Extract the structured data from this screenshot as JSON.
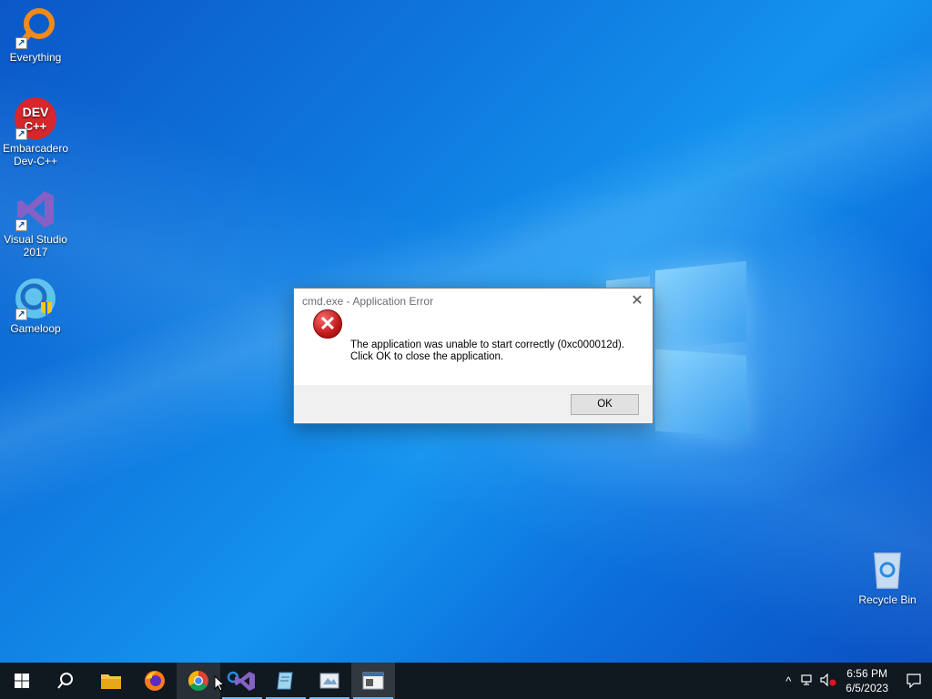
{
  "desktop": {
    "icons": [
      {
        "label": "Everything"
      },
      {
        "label": "Embarcadero Dev-C++",
        "badge": "DEV C++"
      },
      {
        "label": "Visual Studio 2017"
      },
      {
        "label": "Gameloop"
      }
    ],
    "recycle_bin": {
      "label": "Recycle Bin"
    }
  },
  "dialog": {
    "title": "cmd.exe - Application Error",
    "message_line1": "The application was unable to start correctly (0xc000012d).",
    "message_line2": "Click OK to close the application.",
    "ok_label": "OK",
    "close_glyph": "✕",
    "error_glyph": "✕"
  },
  "taskbar": {
    "apps": [
      {
        "name": "file-explorer",
        "running": false
      },
      {
        "name": "firefox",
        "running": false
      },
      {
        "name": "chrome",
        "running": false
      },
      {
        "name": "visual-studio",
        "running": true
      },
      {
        "name": "notepad-app",
        "running": true
      },
      {
        "name": "paint-app",
        "running": true
      },
      {
        "name": "error-window",
        "running": true,
        "active": true
      }
    ],
    "clock": {
      "time": "6:56 PM",
      "date": "6/5/2023"
    },
    "tray_chevron": "^"
  },
  "colors": {
    "desktop_blue": "#0a6fd6",
    "taskbar": "#101820",
    "error_red": "#c31a1a",
    "running_indicator": "#76b9ed"
  }
}
